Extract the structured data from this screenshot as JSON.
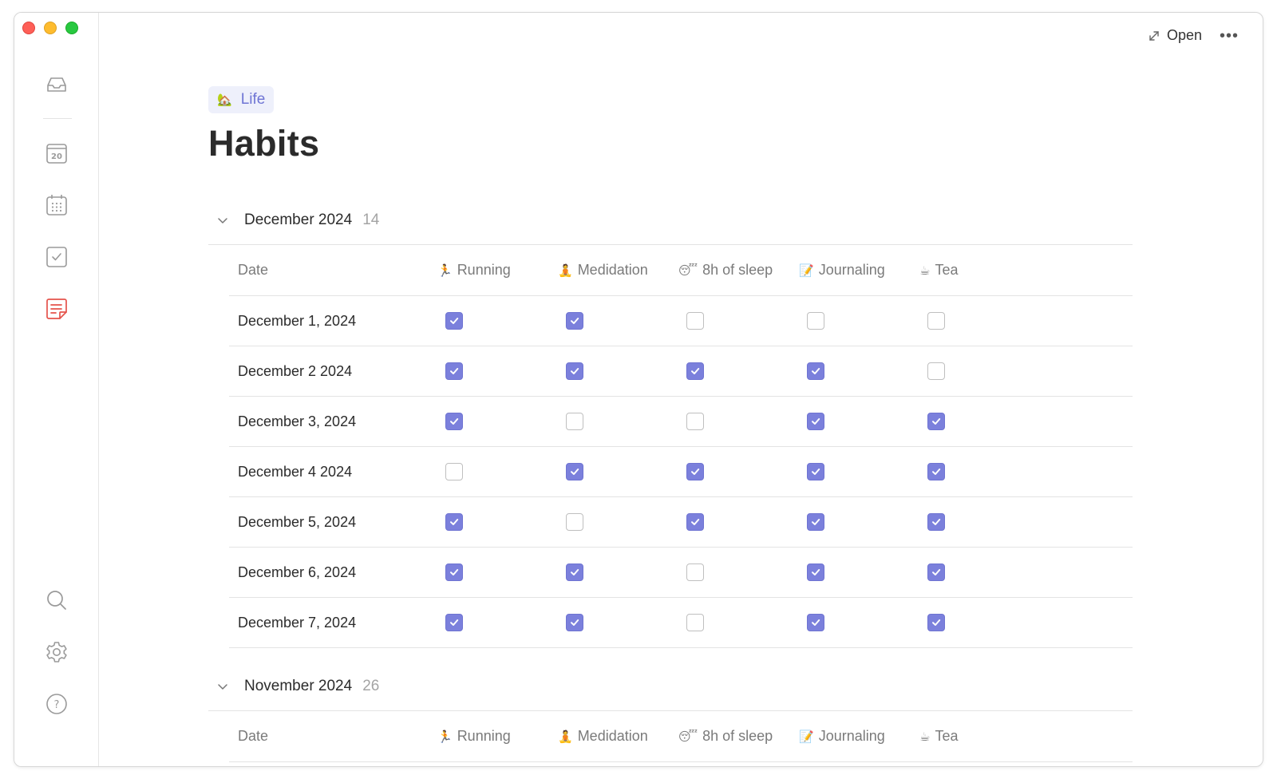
{
  "window": {
    "controls": [
      "close",
      "minimize",
      "zoom"
    ]
  },
  "sidebar": {
    "items": [
      {
        "name": "inbox-icon"
      },
      {
        "name": "today-calendar-icon",
        "label": "20"
      },
      {
        "name": "calendar-grid-icon"
      },
      {
        "name": "tasks-checkbox-icon"
      },
      {
        "name": "notes-icon",
        "active": true,
        "color": "#e5534b"
      }
    ],
    "bottom_items": [
      {
        "name": "search-icon"
      },
      {
        "name": "settings-gear-icon"
      },
      {
        "name": "help-icon",
        "label": "?"
      }
    ]
  },
  "toolbar": {
    "open_label": "Open",
    "more_label": "•••"
  },
  "page": {
    "tag": {
      "emoji": "🏡",
      "label": "Life",
      "color": "#6e74d4"
    },
    "title": "Habits"
  },
  "columns": {
    "date": "Date",
    "habits": [
      {
        "emoji": "🏃",
        "label": "Running"
      },
      {
        "emoji": "🧘",
        "label": "Medidation"
      },
      {
        "emoji": "😴",
        "label": "8h of sleep"
      },
      {
        "emoji": "📝",
        "label": "Journaling"
      },
      {
        "emoji": "☕",
        "label": "Tea"
      }
    ]
  },
  "groups": [
    {
      "title": "December 2024",
      "count": "14",
      "expanded": true,
      "rows": [
        {
          "date": "December 1, 2024",
          "checks": [
            true,
            true,
            false,
            false,
            false
          ]
        },
        {
          "date": "December 2 2024",
          "checks": [
            true,
            true,
            true,
            true,
            false
          ]
        },
        {
          "date": "December 3, 2024",
          "checks": [
            true,
            false,
            false,
            true,
            true
          ]
        },
        {
          "date": "December 4 2024",
          "checks": [
            false,
            true,
            true,
            true,
            true
          ]
        },
        {
          "date": "December 5, 2024",
          "checks": [
            true,
            false,
            true,
            true,
            true
          ]
        },
        {
          "date": "December 6, 2024",
          "checks": [
            true,
            true,
            false,
            true,
            true
          ]
        },
        {
          "date": "December 7, 2024",
          "checks": [
            true,
            true,
            false,
            true,
            true
          ]
        }
      ]
    },
    {
      "title": "November 2024",
      "count": "26",
      "expanded": true,
      "rows": []
    }
  ],
  "colors": {
    "accent": "#7b80dc",
    "divider": "#e3e3e3"
  }
}
